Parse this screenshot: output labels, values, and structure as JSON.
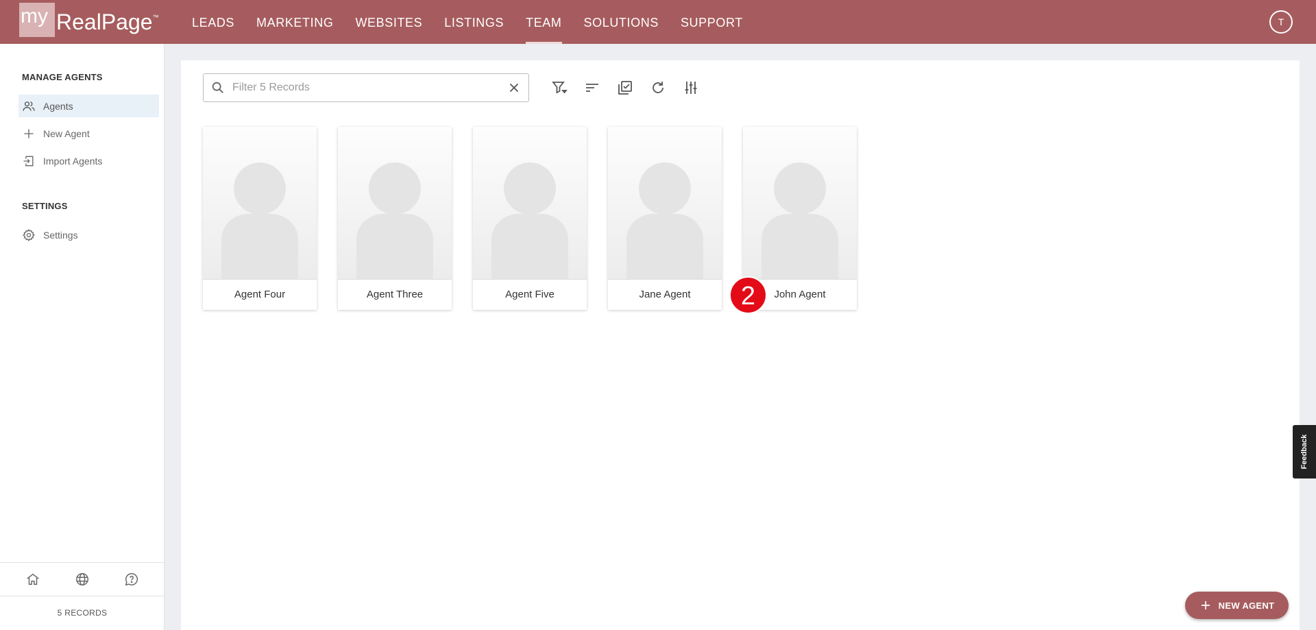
{
  "brand": {
    "logo_my": "my",
    "logo_name": "RealPage",
    "logo_tm": "™"
  },
  "nav": {
    "items": [
      {
        "label": "LEADS"
      },
      {
        "label": "MARKETING"
      },
      {
        "label": "WEBSITES"
      },
      {
        "label": "LISTINGS"
      },
      {
        "label": "TEAM",
        "active": true
      },
      {
        "label": "SOLUTIONS"
      },
      {
        "label": "SUPPORT"
      }
    ],
    "user_initial": "T"
  },
  "sidebar": {
    "section1_title": "MANAGE AGENTS",
    "items": [
      {
        "label": "Agents",
        "icon": "people-icon",
        "active": true
      },
      {
        "label": "New Agent",
        "icon": "plus-icon"
      },
      {
        "label": "Import Agents",
        "icon": "import-icon"
      }
    ],
    "section2_title": "SETTINGS",
    "settings_item": {
      "label": "Settings",
      "icon": "gear-icon"
    },
    "footer_icons": [
      "home-icon",
      "globe-icon",
      "help-chat-icon"
    ],
    "records_label": "5 RECORDS"
  },
  "search": {
    "placeholder": "Filter 5 Records",
    "value": ""
  },
  "toolbar": {
    "icons": [
      "filter-icon",
      "sort-icon",
      "select-all-icon",
      "refresh-icon",
      "column-settings-icon"
    ]
  },
  "agents": [
    {
      "name": "Agent Four"
    },
    {
      "name": "Agent Three"
    },
    {
      "name": "Agent Five"
    },
    {
      "name": "Jane Agent"
    },
    {
      "name": "John Agent"
    }
  ],
  "step_badge": "2",
  "feedback_label": "Feedback",
  "fab_label": "NEW AGENT",
  "colors": {
    "brand": "#a65c5e",
    "badge": "#e30b17",
    "active_bg": "#e8f0f8"
  }
}
